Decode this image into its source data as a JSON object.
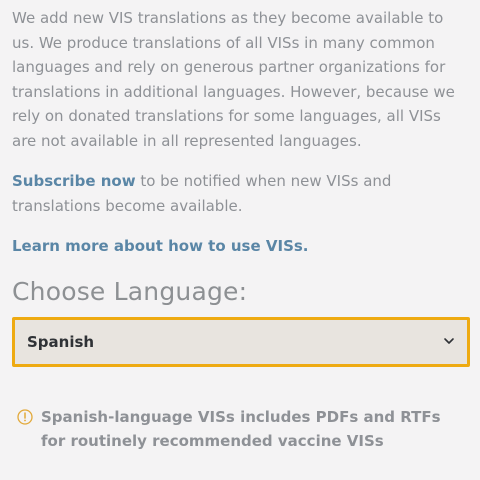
{
  "intro": {
    "paragraph": "We add new VIS translations as they become available to us. We produce translations of all VISs in many common languages and rely on generous partner organizations for translations in additional languages. However, because we rely on donated translations for some languages, all VISs are not available in all represented languages."
  },
  "subscribe": {
    "link_label": "Subscribe now",
    "rest_text": " to be notified when new VISs and translations become available."
  },
  "learn_more": {
    "link_label": "Learn more about how to use VISs."
  },
  "language_chooser": {
    "heading": "Choose Language:",
    "selected_value": "Spanish"
  },
  "notice": {
    "text": "Spanish-language VISs includes PDFs and RTFs for routinely recommended vaccine VISs"
  },
  "colors": {
    "link": "#5a86a6",
    "select_border": "#eeaa11",
    "select_bg": "#e8e4df",
    "info_icon": "#e2a93a"
  },
  "icons": {
    "select": "chevron-down-icon",
    "notice": "info-circle-icon"
  }
}
